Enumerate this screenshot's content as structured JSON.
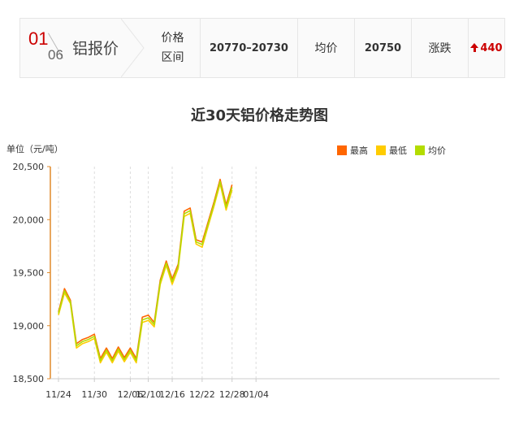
{
  "header": {
    "month": "01",
    "day": "06",
    "metal": "铝报价",
    "range_label": "价格区间",
    "range_value": "20770–20730",
    "avg_label": "均价",
    "avg_value": "20750",
    "change_label": "涨跌",
    "change_value": "440",
    "change_direction": "up",
    "change_color": "#cc0000"
  },
  "chart_data": {
    "type": "line",
    "title": "近30天铝价格走势图",
    "ylabel": "单位（元/吨）",
    "ylim": [
      18500,
      20500
    ],
    "yticks": [
      18500,
      19000,
      19500,
      20000,
      20500
    ],
    "ytick_labels": [
      "18,500",
      "19,000",
      "19,500",
      "20,000",
      "20,500"
    ],
    "grid": "vertical-dashed",
    "legend_position": "top-right",
    "x": [
      "11/24",
      "11/25",
      "11/26",
      "11/29",
      "11/30",
      "12/01",
      "12/02",
      "12/03",
      "12/06",
      "12/07",
      "12/08",
      "12/09",
      "12/10",
      "12/13",
      "12/14",
      "12/15",
      "12/16",
      "12/17",
      "12/20",
      "12/21",
      "12/22",
      "12/23",
      "12/24",
      "12/27",
      "12/28",
      "12/29",
      "12/30",
      "12/31",
      "01/04",
      "01/05",
      "01/06"
    ],
    "xtick_labels": [
      "11/24",
      "11/30",
      "12/06",
      "12/10",
      "12/16",
      "12/22",
      "12/28",
      "01/04"
    ],
    "xtick_index": [
      0,
      6,
      12,
      15,
      19,
      24,
      29,
      33
    ],
    "series": [
      {
        "name": "最高",
        "color": "#ff6600",
        "values": [
          19130,
          19350,
          19240,
          18830,
          18870,
          18890,
          18920,
          18690,
          18790,
          18690,
          18800,
          18700,
          18790,
          18690,
          19080,
          19100,
          19030,
          19430,
          19610,
          19440,
          19580,
          20080,
          20110,
          19810,
          19790,
          19980,
          20170,
          20380,
          20140,
          20330
        ]
      },
      {
        "name": "最低",
        "color": "#ffcc00",
        "values": [
          19100,
          19310,
          19210,
          18790,
          18830,
          18850,
          18880,
          18650,
          18750,
          18650,
          18760,
          18660,
          18750,
          18650,
          19030,
          19050,
          18990,
          19390,
          19570,
          19390,
          19540,
          20030,
          20060,
          19770,
          19740,
          19940,
          20130,
          20340,
          20090,
          20280
        ]
      },
      {
        "name": "均价",
        "color": "#b3dc00",
        "values": [
          19115,
          19330,
          19225,
          18810,
          18850,
          18870,
          18900,
          18670,
          18770,
          18670,
          18780,
          18680,
          18770,
          18670,
          19055,
          19075,
          19010,
          19410,
          19590,
          19415,
          19560,
          20055,
          20085,
          19790,
          19765,
          19960,
          20150,
          20360,
          20115,
          20305
        ]
      }
    ]
  }
}
